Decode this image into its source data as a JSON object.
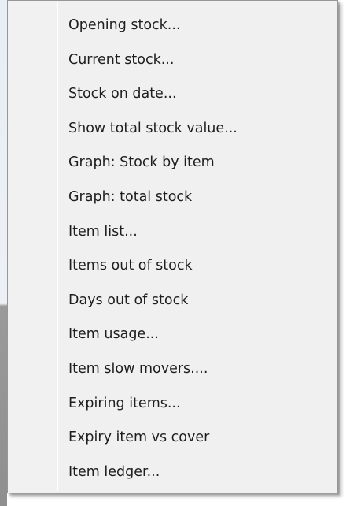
{
  "menu": {
    "items": [
      {
        "label": "Opening stock..."
      },
      {
        "label": "Current stock..."
      },
      {
        "label": "Stock on date..."
      },
      {
        "label": "Show total stock value..."
      },
      {
        "label": "Graph: Stock by item"
      },
      {
        "label": "Graph: total stock"
      },
      {
        "label": "Item list..."
      },
      {
        "label": "Items out of stock"
      },
      {
        "label": "Days out of stock"
      },
      {
        "label": "Item usage..."
      },
      {
        "label": "Item slow movers...."
      },
      {
        "label": "Expiring items..."
      },
      {
        "label": "Expiry item vs cover"
      },
      {
        "label": "Item ledger..."
      }
    ]
  }
}
